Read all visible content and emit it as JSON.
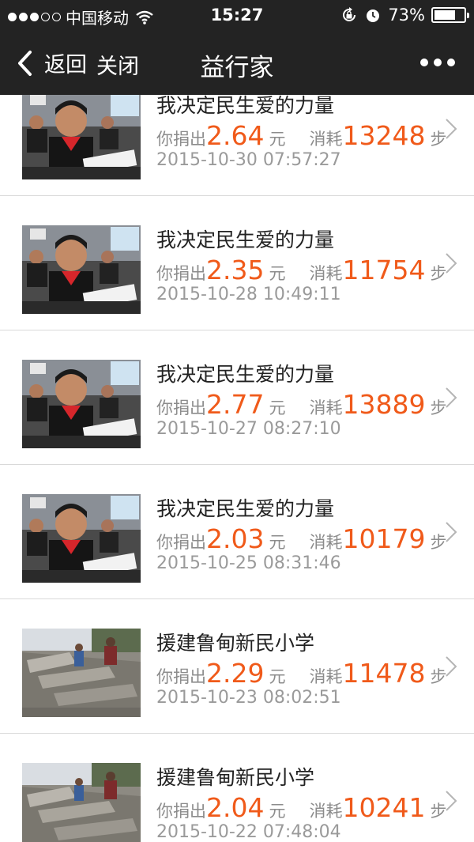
{
  "status_bar": {
    "carrier": "中国移动",
    "time": "15:27",
    "battery_text": "73%",
    "battery_level": 0.73,
    "signal_bars_filled": 3,
    "signal_bars_total": 5
  },
  "nav": {
    "back_label": "返回",
    "close_label": "关闭",
    "title": "益行家"
  },
  "labels": {
    "donate_prefix": "你捐出",
    "currency": "元",
    "consume_prefix": "消耗",
    "steps": "步"
  },
  "items": [
    {
      "title": "我决定民生爱的力量",
      "amount": "2.64",
      "steps": "13248",
      "date": "2015-10-30 07:57:27",
      "image": "classroom-photo"
    },
    {
      "title": "我决定民生爱的力量",
      "amount": "2.35",
      "steps": "11754",
      "date": "2015-10-28 10:49:11",
      "image": "classroom-photo"
    },
    {
      "title": "我决定民生爱的力量",
      "amount": "2.77",
      "steps": "13889",
      "date": "2015-10-27 08:27:10",
      "image": "classroom-photo"
    },
    {
      "title": "我决定民生爱的力量",
      "amount": "2.03",
      "steps": "10179",
      "date": "2015-10-25 08:31:46",
      "image": "classroom-photo"
    },
    {
      "title": "援建鲁甸新民小学",
      "amount": "2.29",
      "steps": "11478",
      "date": "2015-10-23 08:02:51",
      "image": "earthquake-ruins-photo"
    },
    {
      "title": "援建鲁甸新民小学",
      "amount": "2.04",
      "steps": "10241",
      "date": "2015-10-22 07:48:04",
      "image": "earthquake-ruins-photo"
    }
  ],
  "colors": {
    "header_bg": "#232323",
    "accent": "#f05a1a",
    "muted": "#8c8c8c"
  }
}
